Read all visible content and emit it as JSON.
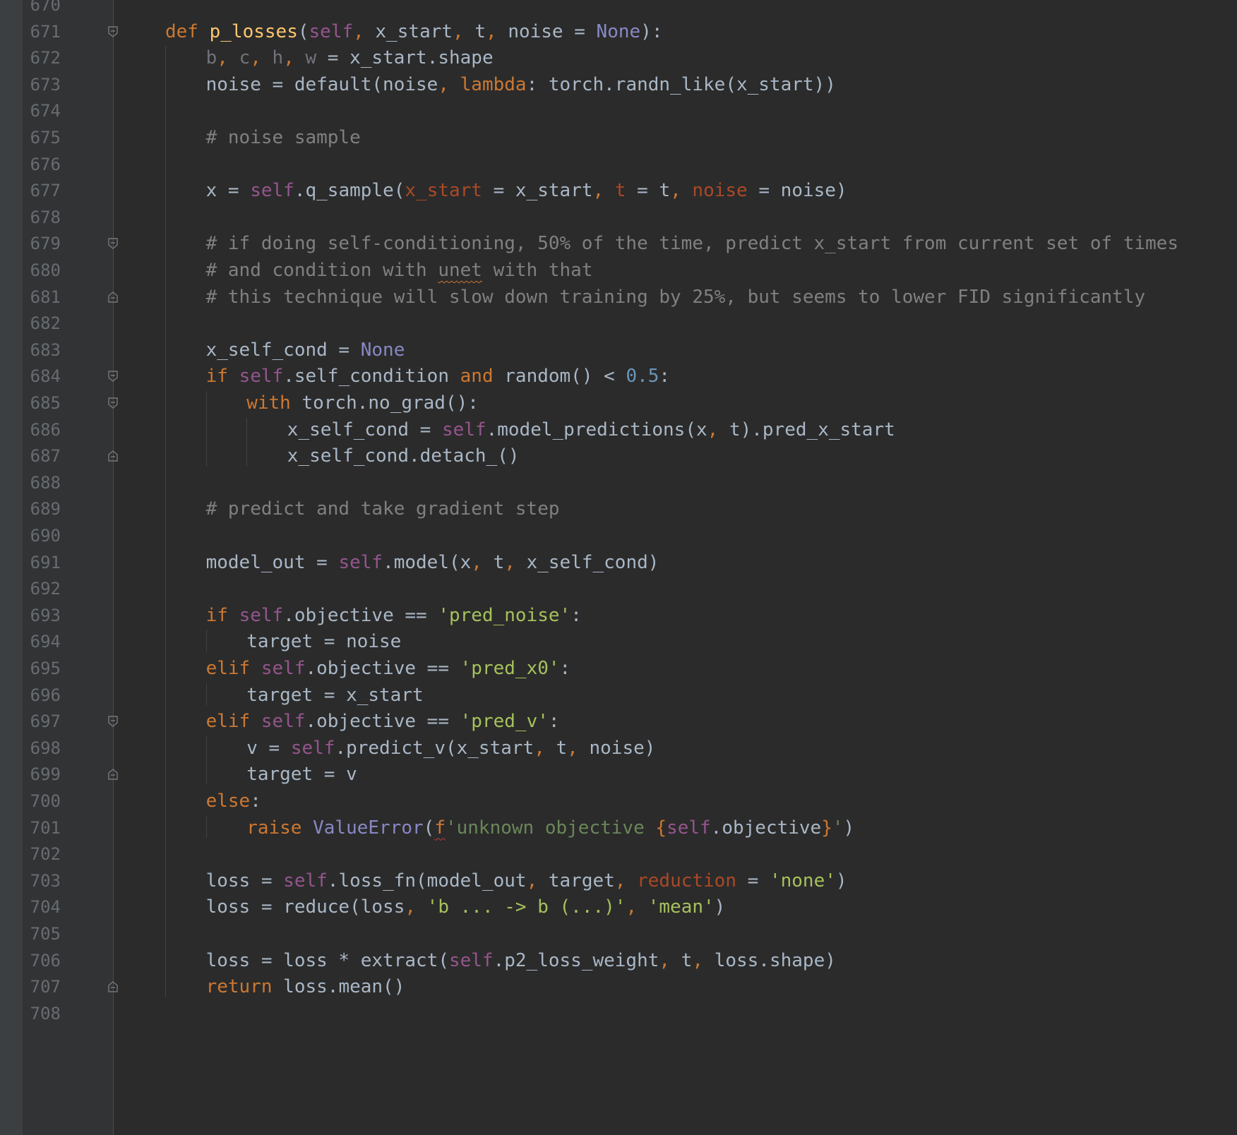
{
  "colors": {
    "background": "#2b2b2b",
    "gutter": "#313335",
    "line_number": "#686c70",
    "keyword": "#cc7832",
    "function_name": "#ffc66d",
    "self": "#94558d",
    "default_text": "#a9b7c6",
    "builtin_const": "#8888c6",
    "number": "#6897bb",
    "string": "#6a8759",
    "string_bright": "#a5c25c",
    "comment": "#808080",
    "named_arg": "#aa4926",
    "unused_var": "#72737a"
  },
  "editor": {
    "lines": [
      {
        "n": "670",
        "indent": 0,
        "fold": "",
        "tokens": []
      },
      {
        "n": "671",
        "indent": 0,
        "fold": "open",
        "tokens": [
          {
            "t": "def ",
            "c": "keyword"
          },
          {
            "t": "p_losses",
            "c": "function_name"
          },
          {
            "t": "(",
            "c": "default_text"
          },
          {
            "t": "self",
            "c": "self"
          },
          {
            "t": ", ",
            "c": "keyword"
          },
          {
            "t": "x_start",
            "c": "default_text"
          },
          {
            "t": ", ",
            "c": "keyword"
          },
          {
            "t": "t",
            "c": "default_text"
          },
          {
            "t": ", ",
            "c": "keyword"
          },
          {
            "t": "noise = ",
            "c": "default_text"
          },
          {
            "t": "None",
            "c": "builtin_const"
          },
          {
            "t": "):",
            "c": "default_text"
          }
        ]
      },
      {
        "n": "672",
        "indent": 1,
        "fold": "",
        "tokens": [
          {
            "t": "b",
            "c": "unused_var"
          },
          {
            "t": ", ",
            "c": "keyword"
          },
          {
            "t": "c",
            "c": "unused_var"
          },
          {
            "t": ", ",
            "c": "keyword"
          },
          {
            "t": "h",
            "c": "unused_var"
          },
          {
            "t": ", ",
            "c": "keyword"
          },
          {
            "t": "w",
            "c": "unused_var"
          },
          {
            "t": " = x_start.shape",
            "c": "default_text"
          }
        ]
      },
      {
        "n": "673",
        "indent": 1,
        "fold": "",
        "tokens": [
          {
            "t": "noise = default(noise",
            "c": "default_text"
          },
          {
            "t": ", ",
            "c": "keyword"
          },
          {
            "t": "lambda",
            "c": "keyword"
          },
          {
            "t": ": torch.randn_like(x_start))",
            "c": "default_text"
          }
        ]
      },
      {
        "n": "674",
        "indent": 1,
        "fold": "",
        "tokens": []
      },
      {
        "n": "675",
        "indent": 1,
        "fold": "",
        "tokens": [
          {
            "t": "# noise sample",
            "c": "comment"
          }
        ]
      },
      {
        "n": "676",
        "indent": 1,
        "fold": "",
        "tokens": []
      },
      {
        "n": "677",
        "indent": 1,
        "fold": "",
        "tokens": [
          {
            "t": "x = ",
            "c": "default_text"
          },
          {
            "t": "self",
            "c": "self"
          },
          {
            "t": ".q_sample(",
            "c": "default_text"
          },
          {
            "t": "x_start",
            "c": "named_arg"
          },
          {
            "t": " = x_start",
            "c": "default_text"
          },
          {
            "t": ", ",
            "c": "keyword"
          },
          {
            "t": "t",
            "c": "named_arg"
          },
          {
            "t": " = t",
            "c": "default_text"
          },
          {
            "t": ", ",
            "c": "keyword"
          },
          {
            "t": "noise",
            "c": "named_arg"
          },
          {
            "t": " = noise)",
            "c": "default_text"
          }
        ]
      },
      {
        "n": "678",
        "indent": 1,
        "fold": "",
        "tokens": []
      },
      {
        "n": "679",
        "indent": 1,
        "fold": "open",
        "tokens": [
          {
            "t": "# if doing self-conditioning, 50% of the time, predict x_start from current set of times",
            "c": "comment"
          }
        ]
      },
      {
        "n": "680",
        "indent": 1,
        "fold": "",
        "tokens": [
          {
            "t": "# and condition with ",
            "c": "comment"
          },
          {
            "t": "unet",
            "c": "comment",
            "u": "squiggle"
          },
          {
            "t": " with that",
            "c": "comment"
          }
        ]
      },
      {
        "n": "681",
        "indent": 1,
        "fold": "close",
        "tokens": [
          {
            "t": "# this technique will slow down training by 25%, but seems to lower FID significantly",
            "c": "comment"
          }
        ]
      },
      {
        "n": "682",
        "indent": 1,
        "fold": "",
        "tokens": []
      },
      {
        "n": "683",
        "indent": 1,
        "fold": "",
        "tokens": [
          {
            "t": "x_self_cond = ",
            "c": "default_text"
          },
          {
            "t": "None",
            "c": "builtin_const"
          }
        ]
      },
      {
        "n": "684",
        "indent": 1,
        "fold": "open",
        "tokens": [
          {
            "t": "if ",
            "c": "keyword"
          },
          {
            "t": "self",
            "c": "self"
          },
          {
            "t": ".self_condition ",
            "c": "default_text"
          },
          {
            "t": "and ",
            "c": "keyword"
          },
          {
            "t": "random() < ",
            "c": "default_text"
          },
          {
            "t": "0.5",
            "c": "number"
          },
          {
            "t": ":",
            "c": "default_text"
          }
        ]
      },
      {
        "n": "685",
        "indent": 2,
        "fold": "open",
        "tokens": [
          {
            "t": "with ",
            "c": "keyword"
          },
          {
            "t": "torch.no_grad():",
            "c": "default_text"
          }
        ]
      },
      {
        "n": "686",
        "indent": 3,
        "fold": "",
        "tokens": [
          {
            "t": "x_self_cond = ",
            "c": "default_text"
          },
          {
            "t": "self",
            "c": "self"
          },
          {
            "t": ".model_predictions(x",
            "c": "default_text"
          },
          {
            "t": ", ",
            "c": "keyword"
          },
          {
            "t": "t).pred_x_start",
            "c": "default_text"
          }
        ]
      },
      {
        "n": "687",
        "indent": 3,
        "fold": "close",
        "tokens": [
          {
            "t": "x_self_cond.detach_()",
            "c": "default_text"
          }
        ]
      },
      {
        "n": "688",
        "indent": 1,
        "fold": "",
        "tokens": []
      },
      {
        "n": "689",
        "indent": 1,
        "fold": "",
        "tokens": [
          {
            "t": "# predict and take gradient step",
            "c": "comment"
          }
        ]
      },
      {
        "n": "690",
        "indent": 1,
        "fold": "",
        "tokens": []
      },
      {
        "n": "691",
        "indent": 1,
        "fold": "",
        "tokens": [
          {
            "t": "model_out = ",
            "c": "default_text"
          },
          {
            "t": "self",
            "c": "self"
          },
          {
            "t": ".model(x",
            "c": "default_text"
          },
          {
            "t": ", ",
            "c": "keyword"
          },
          {
            "t": "t",
            "c": "default_text"
          },
          {
            "t": ", ",
            "c": "keyword"
          },
          {
            "t": "x_self_cond)",
            "c": "default_text"
          }
        ]
      },
      {
        "n": "692",
        "indent": 1,
        "fold": "",
        "tokens": []
      },
      {
        "n": "693",
        "indent": 1,
        "fold": "",
        "tokens": [
          {
            "t": "if ",
            "c": "keyword"
          },
          {
            "t": "self",
            "c": "self"
          },
          {
            "t": ".objective == ",
            "c": "default_text"
          },
          {
            "t": "'pred_noise'",
            "c": "string_bright"
          },
          {
            "t": ":",
            "c": "default_text"
          }
        ]
      },
      {
        "n": "694",
        "indent": 2,
        "fold": "",
        "tokens": [
          {
            "t": "target = noise",
            "c": "default_text"
          }
        ]
      },
      {
        "n": "695",
        "indent": 1,
        "fold": "",
        "tokens": [
          {
            "t": "elif ",
            "c": "keyword"
          },
          {
            "t": "self",
            "c": "self"
          },
          {
            "t": ".objective == ",
            "c": "default_text"
          },
          {
            "t": "'pred_x0'",
            "c": "string_bright"
          },
          {
            "t": ":",
            "c": "default_text"
          }
        ]
      },
      {
        "n": "696",
        "indent": 2,
        "fold": "",
        "tokens": [
          {
            "t": "target = x_start",
            "c": "default_text"
          }
        ]
      },
      {
        "n": "697",
        "indent": 1,
        "fold": "open",
        "tokens": [
          {
            "t": "elif ",
            "c": "keyword"
          },
          {
            "t": "self",
            "c": "self"
          },
          {
            "t": ".objective == ",
            "c": "default_text"
          },
          {
            "t": "'pred_v'",
            "c": "string_bright"
          },
          {
            "t": ":",
            "c": "default_text"
          }
        ]
      },
      {
        "n": "698",
        "indent": 2,
        "fold": "",
        "tokens": [
          {
            "t": "v = ",
            "c": "default_text"
          },
          {
            "t": "self",
            "c": "self"
          },
          {
            "t": ".predict_v(x_start",
            "c": "default_text"
          },
          {
            "t": ", ",
            "c": "keyword"
          },
          {
            "t": "t",
            "c": "default_text"
          },
          {
            "t": ", ",
            "c": "keyword"
          },
          {
            "t": "noise)",
            "c": "default_text"
          }
        ]
      },
      {
        "n": "699",
        "indent": 2,
        "fold": "close",
        "tokens": [
          {
            "t": "target = v",
            "c": "default_text"
          }
        ]
      },
      {
        "n": "700",
        "indent": 1,
        "fold": "",
        "tokens": [
          {
            "t": "else",
            "c": "keyword"
          },
          {
            "t": ":",
            "c": "default_text"
          }
        ]
      },
      {
        "n": "701",
        "indent": 2,
        "fold": "",
        "tokens": [
          {
            "t": "raise ",
            "c": "keyword"
          },
          {
            "t": "ValueError",
            "c": "builtin_const"
          },
          {
            "t": "(",
            "c": "default_text"
          },
          {
            "t": "f",
            "c": "keyword",
            "u": "squiggle-red"
          },
          {
            "t": "'unknown objective ",
            "c": "string"
          },
          {
            "t": "{",
            "c": "keyword"
          },
          {
            "t": "self",
            "c": "self"
          },
          {
            "t": ".objective",
            "c": "default_text"
          },
          {
            "t": "}",
            "c": "keyword"
          },
          {
            "t": "'",
            "c": "string"
          },
          {
            "t": ")",
            "c": "default_text"
          }
        ]
      },
      {
        "n": "702",
        "indent": 1,
        "fold": "",
        "tokens": []
      },
      {
        "n": "703",
        "indent": 1,
        "fold": "",
        "tokens": [
          {
            "t": "loss = ",
            "c": "default_text"
          },
          {
            "t": "self",
            "c": "self"
          },
          {
            "t": ".loss_fn(model_out",
            "c": "default_text"
          },
          {
            "t": ", ",
            "c": "keyword"
          },
          {
            "t": "target",
            "c": "default_text"
          },
          {
            "t": ", ",
            "c": "keyword"
          },
          {
            "t": "reduction",
            "c": "named_arg"
          },
          {
            "t": " = ",
            "c": "default_text"
          },
          {
            "t": "'none'",
            "c": "string_bright"
          },
          {
            "t": ")",
            "c": "default_text"
          }
        ]
      },
      {
        "n": "704",
        "indent": 1,
        "fold": "",
        "tokens": [
          {
            "t": "loss = reduce(loss",
            "c": "default_text"
          },
          {
            "t": ", ",
            "c": "keyword"
          },
          {
            "t": "'b ... -> b (...)'",
            "c": "string_bright"
          },
          {
            "t": ", ",
            "c": "keyword"
          },
          {
            "t": "'mean'",
            "c": "string_bright"
          },
          {
            "t": ")",
            "c": "default_text"
          }
        ]
      },
      {
        "n": "705",
        "indent": 1,
        "fold": "",
        "tokens": []
      },
      {
        "n": "706",
        "indent": 1,
        "fold": "",
        "tokens": [
          {
            "t": "loss = loss * extract(",
            "c": "default_text"
          },
          {
            "t": "self",
            "c": "self"
          },
          {
            "t": ".p2_loss_weight",
            "c": "default_text"
          },
          {
            "t": ", ",
            "c": "keyword"
          },
          {
            "t": "t",
            "c": "default_text"
          },
          {
            "t": ", ",
            "c": "keyword"
          },
          {
            "t": "loss.shape)",
            "c": "default_text"
          }
        ]
      },
      {
        "n": "707",
        "indent": 1,
        "fold": "close",
        "tokens": [
          {
            "t": "return ",
            "c": "keyword"
          },
          {
            "t": "loss.mean()",
            "c": "default_text"
          }
        ]
      },
      {
        "n": "708",
        "indent": 0,
        "fold": "",
        "tokens": []
      }
    ]
  }
}
